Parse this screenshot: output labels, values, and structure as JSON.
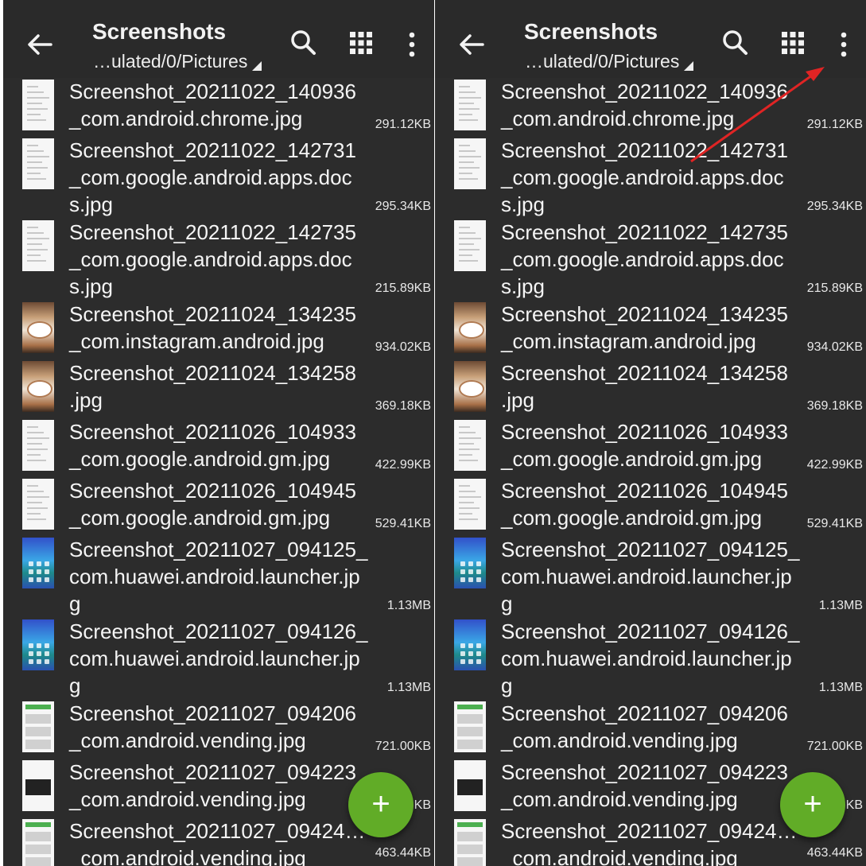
{
  "appbar": {
    "title": "Screenshots",
    "path": "…ulated/0/Pictures"
  },
  "files": [
    {
      "lines": [
        "Screenshot_20211022_140936",
        "_com.android.chrome.jpg"
      ],
      "size": "291.12KB",
      "thumb": "doc"
    },
    {
      "lines": [
        "Screenshot_20211022_142731",
        "_com.google.android.apps.doc",
        "s.jpg"
      ],
      "size": "295.34KB",
      "thumb": "doc"
    },
    {
      "lines": [
        "Screenshot_20211022_142735",
        "_com.google.android.apps.doc",
        "s.jpg"
      ],
      "size": "215.89KB",
      "thumb": "doc"
    },
    {
      "lines": [
        "Screenshot_20211024_134235",
        "_com.instagram.android.jpg"
      ],
      "size": "934.02KB",
      "thumb": "photo"
    },
    {
      "lines": [
        "Screenshot_20211024_134258",
        ".jpg"
      ],
      "size": "369.18KB",
      "thumb": "photo"
    },
    {
      "lines": [
        "Screenshot_20211026_104933",
        "_com.google.android.gm.jpg"
      ],
      "size": "422.99KB",
      "thumb": "doc"
    },
    {
      "lines": [
        "Screenshot_20211026_104945",
        "_com.google.android.gm.jpg"
      ],
      "size": "529.41KB",
      "thumb": "doc"
    },
    {
      "lines": [
        "Screenshot_20211027_094125_",
        "com.huawei.android.launcher.jp",
        "g"
      ],
      "size": "1.13MB",
      "thumb": "phone"
    },
    {
      "lines": [
        "Screenshot_20211027_094126_",
        "com.huawei.android.launcher.jp",
        "g"
      ],
      "size": "1.13MB",
      "thumb": "phone"
    },
    {
      "lines": [
        "Screenshot_20211027_094206",
        "_com.android.vending.jpg"
      ],
      "size": "721.00KB",
      "thumb": "store"
    },
    {
      "lines": [
        "Screenshot_20211027_094223",
        "_com.android.vending.jpg"
      ],
      "size": "…KB",
      "thumb": "dark"
    },
    {
      "lines": [
        "Screenshot_20211027_09424…",
        "_com.android.vending.jpg"
      ],
      "size": "463.44KB",
      "thumb": "store"
    }
  ],
  "fab": {
    "label": "+"
  },
  "icons": {
    "back": "arrow-left-icon",
    "search": "search-icon",
    "view": "grid-view-icon",
    "more": "more-vertical-icon",
    "fab": "plus-icon"
  },
  "colors": {
    "background": "#2c2c2c",
    "fab": "#61ac27",
    "annotation_arrow": "#e02424"
  }
}
